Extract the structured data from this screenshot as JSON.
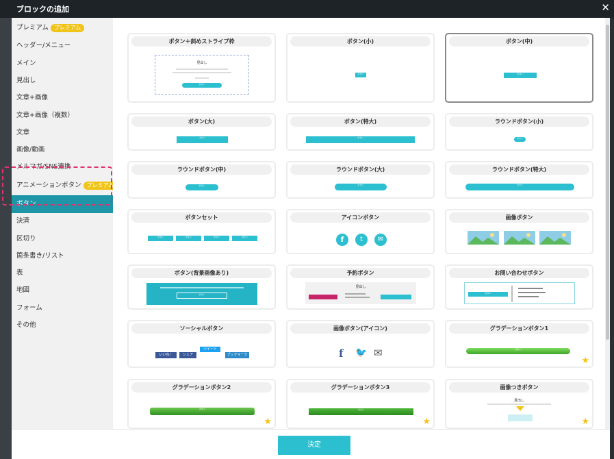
{
  "modal": {
    "title": "ブロックの追加",
    "close_icon": "close-icon",
    "confirm_label": "決定"
  },
  "colors": {
    "accent": "#2bbfd0",
    "active_item": "#1e96a8",
    "premium_badge": "#f0c419",
    "highlight": "#e0336e",
    "star": "#f3c317"
  },
  "sidebar": {
    "items": [
      {
        "label": "プレミアム",
        "badge": "プレミアム"
      },
      {
        "label": "ヘッダー/メニュー"
      },
      {
        "label": "メイン"
      },
      {
        "label": "見出し"
      },
      {
        "label": "文章+画像"
      },
      {
        "label": "文章+画像（複数）"
      },
      {
        "label": "文章"
      },
      {
        "label": "画像/動画"
      },
      {
        "label": "メルマガ/SNS連携"
      },
      {
        "label": "アニメーションボタン",
        "badge": "プレミアム"
      },
      {
        "label": "ボタン",
        "active": true
      },
      {
        "label": "決済"
      },
      {
        "label": "区切り"
      },
      {
        "label": "箇条書き/リスト"
      },
      {
        "label": "表"
      },
      {
        "label": "地図"
      },
      {
        "label": "フォーム"
      },
      {
        "label": "その他"
      }
    ]
  },
  "cards": [
    {
      "title": "ボタン＋斜めストライプ枠",
      "preview": {
        "heading": "見出し",
        "button": "ボタン"
      }
    },
    {
      "title": "ボタン(小)",
      "preview": {
        "button": "ボタン"
      }
    },
    {
      "title": "ボタン(中)",
      "selected": true,
      "preview": {
        "button": "ボタン"
      }
    },
    {
      "title": "ボタン(大)",
      "preview": {
        "button": "ボタン"
      }
    },
    {
      "title": "ボタン(特大)",
      "preview": {
        "button": "ボタン"
      }
    },
    {
      "title": "ラウンドボタン(小)",
      "preview": {
        "button": "ボタン"
      }
    },
    {
      "title": "ラウンドボタン(中)",
      "preview": {
        "button": "ボタン"
      }
    },
    {
      "title": "ラウンドボタン(大)",
      "preview": {
        "button": "ボタン"
      }
    },
    {
      "title": "ラウンドボタン(特大)",
      "preview": {
        "button": "ボタン"
      }
    },
    {
      "title": "ボタンセット",
      "preview": {
        "button": "ボタン"
      }
    },
    {
      "title": "アイコンボタン",
      "preview": {
        "icons": [
          "facebook-icon",
          "twitter-icon",
          "mail-icon"
        ]
      }
    },
    {
      "title": "画像ボタン",
      "preview": {
        "images": 3
      }
    },
    {
      "title": "ボタン(背景画像あり)",
      "preview": {
        "button": "ボタン"
      }
    },
    {
      "title": "予約ボタン",
      "preview": {
        "heading": "見出し"
      }
    },
    {
      "title": "お問い合わせボタン",
      "preview": {
        "button": "ボタン"
      }
    },
    {
      "title": "ソーシャルボタン",
      "preview": {
        "like": "いいね！",
        "share": "シェア",
        "tweet": "ツイート",
        "bookmark": "ブックマーク"
      }
    },
    {
      "title": "画像ボタン(アイコン)",
      "preview": {
        "icons": [
          "facebook-icon",
          "twitter-icon",
          "mail-icon"
        ]
      }
    },
    {
      "title": "グラデーションボタン1",
      "premium_star": true,
      "preview": {
        "button": "ボタン"
      }
    },
    {
      "title": "グラデーションボタン2",
      "premium_star": true,
      "preview": {
        "button": "ボタン"
      }
    },
    {
      "title": "グラデーションボタン3",
      "premium_star": true,
      "preview": {
        "button": "ボタン"
      }
    },
    {
      "title": "画像つきボタン",
      "premium_star": true,
      "preview": {
        "heading": "見出し"
      }
    }
  ]
}
